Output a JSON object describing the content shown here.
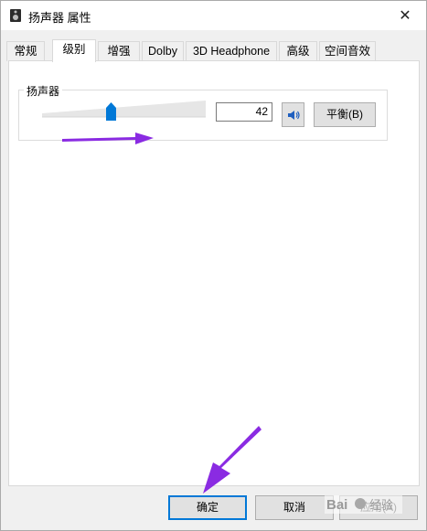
{
  "window": {
    "title": "扬声器 属性",
    "close_glyph": "✕"
  },
  "tabs": [
    {
      "label": "常规",
      "active": false
    },
    {
      "label": "级别",
      "active": true
    },
    {
      "label": "增强",
      "active": false
    },
    {
      "label": "Dolby",
      "active": false
    },
    {
      "label": "3D Headphone",
      "active": false
    },
    {
      "label": "高级",
      "active": false
    },
    {
      "label": "空间音效",
      "active": false
    }
  ],
  "level": {
    "group_label": "扬声器",
    "value": "42",
    "mute_icon": "speaker-volume-icon",
    "balance_label": "平衡(B)"
  },
  "footer": {
    "ok_label": "确定",
    "cancel_label": "取消",
    "apply_label": "应用(A)"
  },
  "annotations": {
    "arrow_color": "#8a2be2"
  },
  "watermark": "Bai 经验"
}
